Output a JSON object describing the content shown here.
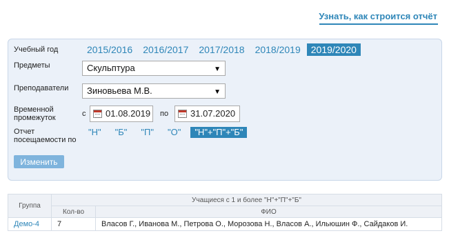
{
  "header": {
    "link": "Узнать, как строится отчёт"
  },
  "filters": {
    "year_label": "Учебный год",
    "years": [
      "2015/2016",
      "2016/2017",
      "2017/2018",
      "2018/2019",
      "2019/2020"
    ],
    "active_year": "2019/2020",
    "subjects_label": "Предметы",
    "subject_value": "Скульптура",
    "teachers_label": "Преподаватели",
    "teacher_value": "Зиновьева М.В.",
    "period_label_1": "Временной",
    "period_label_2": "промежуток",
    "from_label": "с",
    "from_value": "01.08.2019",
    "to_label": "по",
    "to_value": "31.07.2020",
    "attendance_label_1": "Отчет",
    "attendance_label_2": "посещаемости по",
    "attendance_options": [
      "\"Н\"",
      "\"Б\"",
      "\"П\"",
      "\"О\"",
      "\"Н\"+\"П\"+\"Б\""
    ],
    "active_attendance": "\"Н\"+\"П\"+\"Б\"",
    "submit_label": "Изменить"
  },
  "table": {
    "group_header": "Группа",
    "students_header": "Учащиеся с 1 и более \"Н\"+\"П\"+\"Б\"",
    "count_header": "Кол-во",
    "name_header": "ФИО",
    "rows": [
      {
        "group": "Демо-4",
        "count": "7",
        "names": "Власов Г., Иванова М., Петрова О., Морозова Н., Власов А., Ильюшин Ф., Сайдаков И."
      }
    ]
  }
}
